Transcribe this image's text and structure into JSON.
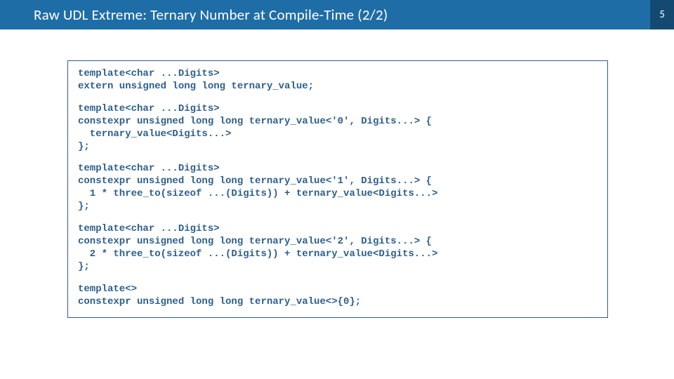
{
  "header": {
    "title": "Raw UDL Extreme: Ternary Number at Compile-Time (2/2)",
    "page_number": "5"
  },
  "code": {
    "blocks": [
      "template<char ...Digits>\nextern unsigned long long ternary_value;",
      "template<char ...Digits>\nconstexpr unsigned long long ternary_value<'0', Digits...> {\n  ternary_value<Digits...>\n};",
      "template<char ...Digits>\nconstexpr unsigned long long ternary_value<'1', Digits...> {\n  1 * three_to(sizeof ...(Digits)) + ternary_value<Digits...>\n};",
      "template<char ...Digits>\nconstexpr unsigned long long ternary_value<'2', Digits...> {\n  2 * three_to(sizeof ...(Digits)) + ternary_value<Digits...>\n};",
      "template<>\nconstexpr unsigned long long ternary_value<>{0};"
    ]
  }
}
